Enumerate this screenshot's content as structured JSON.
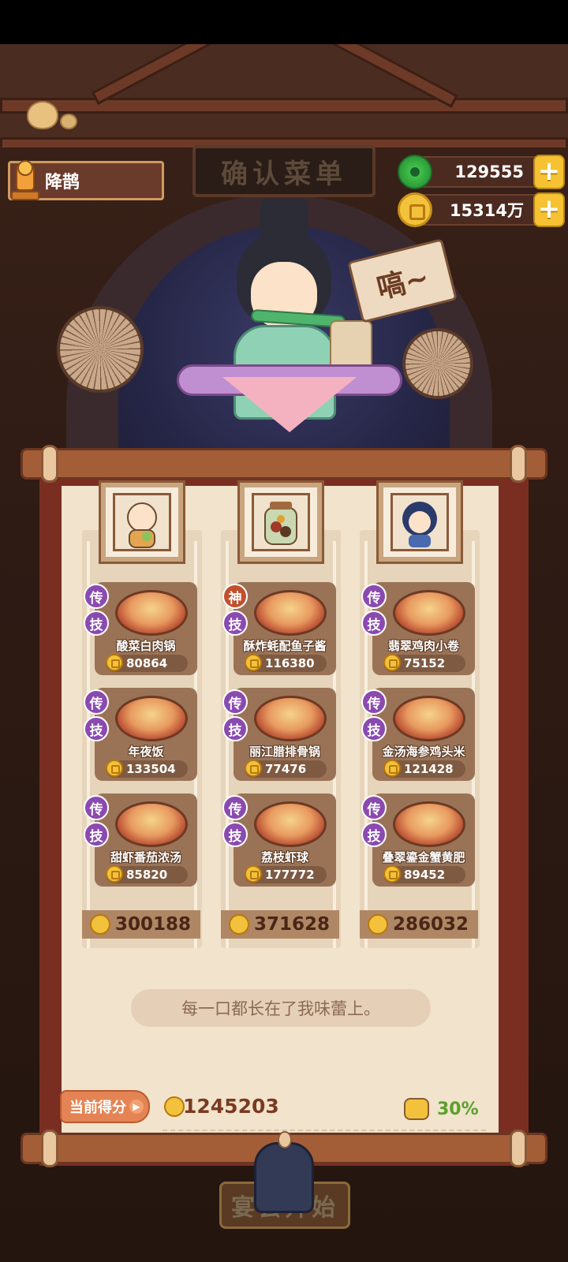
{
  "header": {
    "title_plaque": "确认菜单",
    "player_name": "降鹊",
    "jade_amount": "129555",
    "coin_amount": "15314万",
    "plus_label": "+"
  },
  "scene": {
    "sound_sign": "嗃~"
  },
  "columns": [
    {
      "portrait": "bald-monk-portrait",
      "dishes": [
        {
          "badge": "传",
          "badge2": "技",
          "name": "酸菜白肉锅",
          "price": "80864"
        },
        {
          "badge": "传",
          "badge2": "技",
          "name": "年夜饭",
          "price": "133504"
        },
        {
          "badge": "传",
          "badge2": "技",
          "name": "甜虾番茄浓汤",
          "price": "85820"
        }
      ],
      "total": "300188"
    },
    {
      "portrait": "spice-jar-portrait",
      "dishes": [
        {
          "badge": "神",
          "badge2": "技",
          "name": "酥炸蚝配鱼子酱",
          "price": "116380"
        },
        {
          "badge": "传",
          "badge2": "技",
          "name": "丽江腊排骨锅",
          "price": "77476"
        },
        {
          "badge": "传",
          "badge2": "技",
          "name": "荔枝虾球",
          "price": "177772"
        }
      ],
      "total": "371628"
    },
    {
      "portrait": "blue-hair-girl-portrait",
      "dishes": [
        {
          "badge": "传",
          "badge2": "技",
          "name": "翡翠鸡肉小卷",
          "price": "75152"
        },
        {
          "badge": "传",
          "badge2": "技",
          "name": "金汤海参鸡头米",
          "price": "121428"
        },
        {
          "badge": "传",
          "badge2": "技",
          "name": "叠翠鎏金蟹黄肥",
          "price": "89452"
        }
      ],
      "total": "286032"
    }
  ],
  "quote": "每一口都长在了我味蕾上。",
  "score": {
    "label": "当前得分",
    "value": "1245203",
    "bonus": "30%"
  },
  "start_button": "宴会开始",
  "colors": {
    "badge_chuan": "#8a4ab0",
    "badge_shen": "#c2502c",
    "bonus_green": "#5aa02c",
    "paper": "#f1e3cc"
  }
}
